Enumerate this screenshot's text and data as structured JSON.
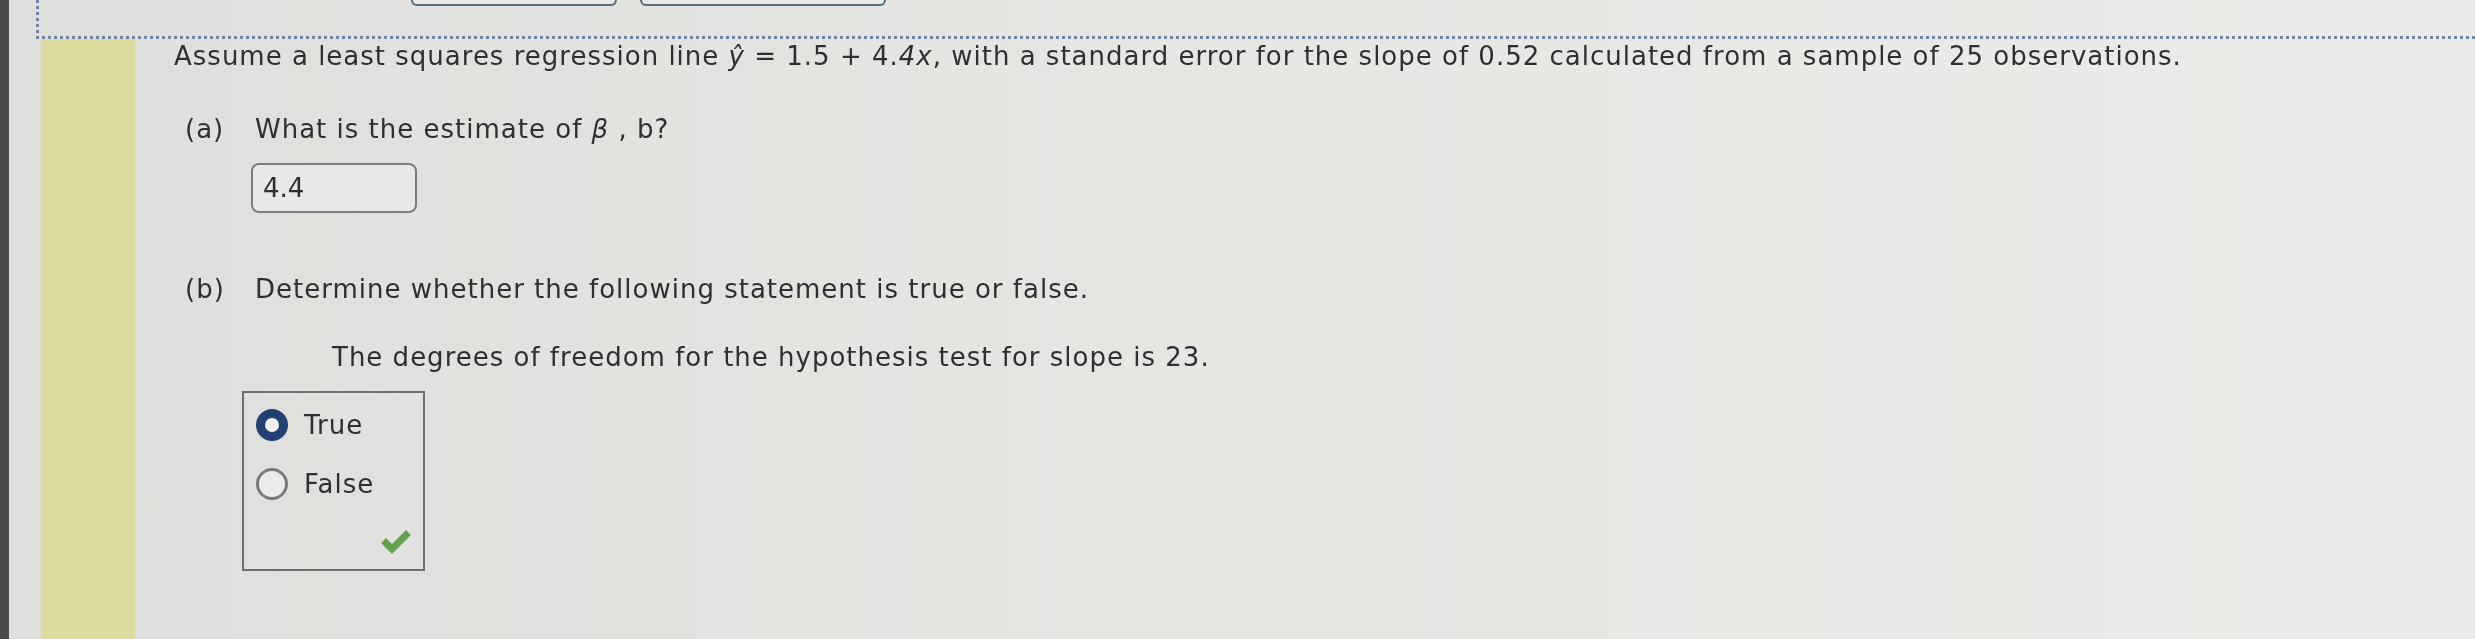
{
  "stem": "Assume a least squares regression line *ŷ* = 1.5 + 4.*4x*, with a standard error for the slope of 0.52 calculated from a sample of 25 observations.",
  "parts": [
    {
      "kind": "numeric",
      "label": "(a)",
      "prompt": "What is the estimate of *β* , b?",
      "answer": "4.4"
    },
    {
      "kind": "choice",
      "label": "(b)",
      "prompt": "Determine whether the following statement is true or false.",
      "statement": "The degrees of freedom for the hypothesis test for slope is 23.",
      "options": [
        {
          "label": "True",
          "selected": true
        },
        {
          "label": "False",
          "selected": false
        }
      ],
      "correct": true
    }
  ]
}
